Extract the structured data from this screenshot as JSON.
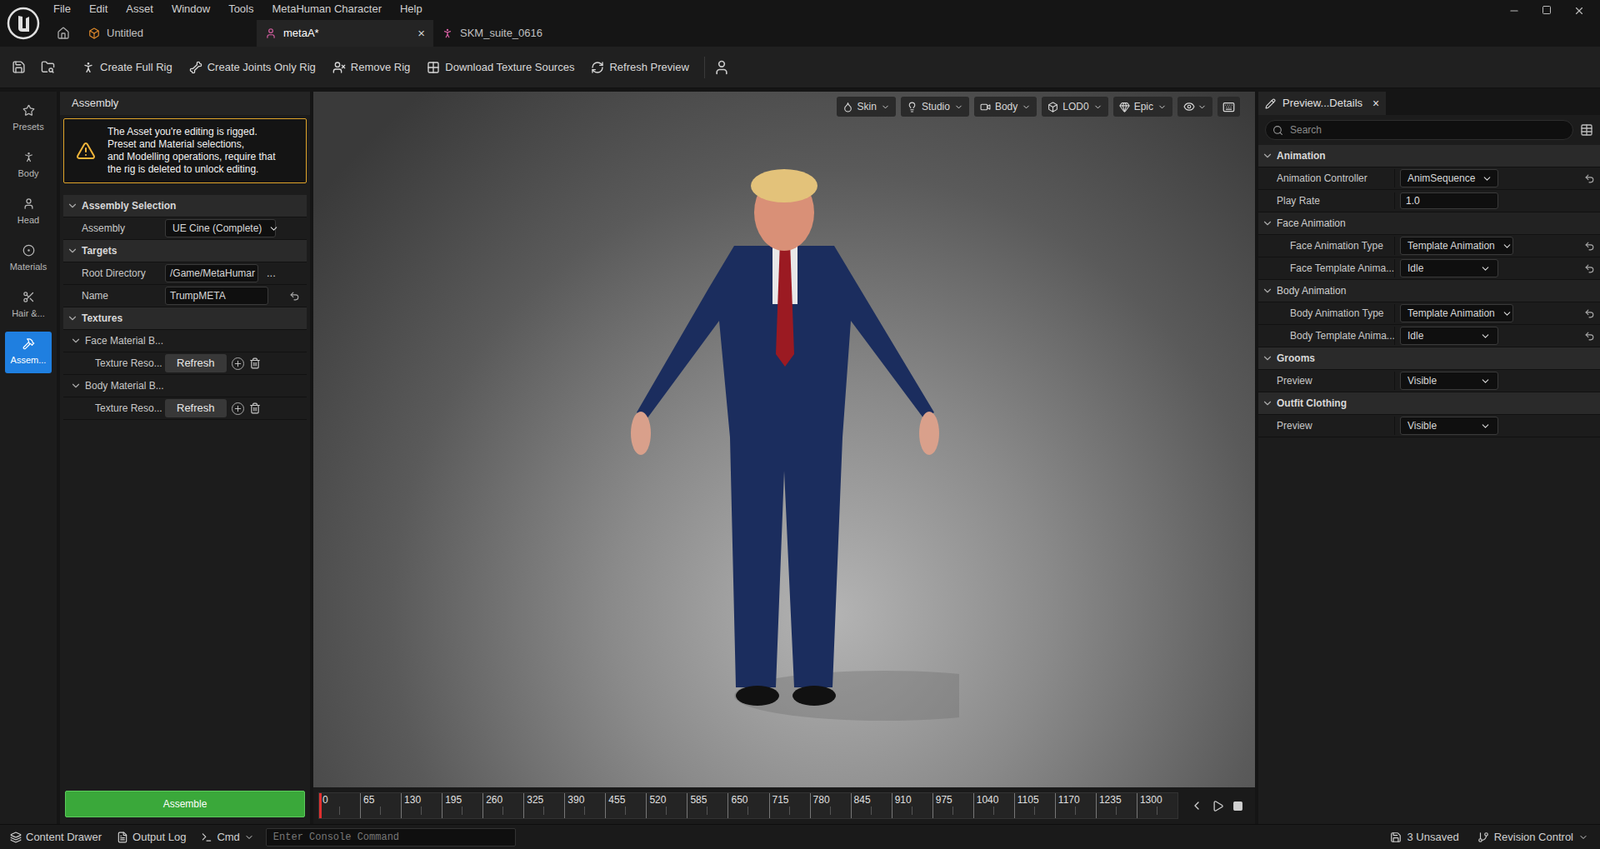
{
  "menu": [
    "File",
    "Edit",
    "Asset",
    "Window",
    "Tools",
    "MetaHuman Character",
    "Help"
  ],
  "tabs": [
    {
      "label": "Untitled",
      "selected": false,
      "close": ""
    },
    {
      "label": "metaA*",
      "selected": true,
      "close": "×"
    },
    {
      "label": "SKM_suite_0616",
      "selected": false,
      "close": ""
    }
  ],
  "toolbar": [
    "Create Full Rig",
    "Create Joints Only Rig",
    "Remove Rig",
    "Download Texture Sources",
    "Refresh Preview"
  ],
  "sidebar": {
    "items": [
      {
        "label": "Presets",
        "selected": false
      },
      {
        "label": "Body",
        "selected": false
      },
      {
        "label": "Head",
        "selected": false
      },
      {
        "label": "Materials",
        "selected": false
      },
      {
        "label": "Hair &...",
        "selected": false
      },
      {
        "label": "Assem...",
        "selected": true
      }
    ]
  },
  "assembly_panel": {
    "title": "Assembly",
    "warning": [
      "The Asset you're editing is rigged.",
      "Preset and Material selections,",
      "and Modelling operations, require that",
      "the rig is deleted to unlock editing."
    ],
    "sections": [
      {
        "title": "Assembly Selection",
        "expanded": true,
        "rows": [
          {
            "kind": "dropdown",
            "label": "Assembly",
            "value": "UE Cine (Complete)",
            "reset": false
          }
        ]
      },
      {
        "title": "Targets",
        "expanded": true,
        "rows": [
          {
            "kind": "path",
            "label": "Root Directory",
            "value": "/Game/MetaHumar",
            "button": "...",
            "reset": false
          },
          {
            "kind": "text",
            "label": "Name",
            "value": "TrumpMETA",
            "reset": true
          }
        ]
      },
      {
        "title": "Textures",
        "expanded": true,
        "rows": [
          {
            "kind": "group",
            "label": "Face Material B...",
            "expanded": true
          },
          {
            "kind": "refresh",
            "label": "Texture Reso...",
            "value": "Refresh"
          },
          {
            "kind": "group",
            "label": "Body Material B...",
            "expanded": true
          },
          {
            "kind": "refresh",
            "label": "Texture Reso...",
            "value": "Refresh"
          }
        ]
      }
    ],
    "assemble_button": "Assemble"
  },
  "viewport": {
    "toolbar": [
      "Skin",
      "Studio",
      "Body",
      "LOD0",
      "Epic"
    ]
  },
  "timeline": {
    "ticks": [
      "0",
      "65",
      "130",
      "195",
      "260",
      "325",
      "390",
      "455",
      "520",
      "585",
      "650",
      "715",
      "780",
      "845",
      "910",
      "975",
      "1040",
      "1105",
      "1170",
      "1235",
      "1300"
    ],
    "level": 0
  },
  "details": {
    "tab": "Preview...Details",
    "close": "×",
    "search_placeholder": "Search",
    "sections": [
      {
        "title": "Animation",
        "level": 0,
        "expanded": true,
        "rows": [
          {
            "kind": "dropdown",
            "label": "Animation Controller",
            "value": "AnimSequence",
            "reset": true
          },
          {
            "kind": "input",
            "label": "Play Rate",
            "value": "1.0",
            "reset": false
          }
        ]
      },
      {
        "title": "Face Animation",
        "level": 0,
        "expanded": true,
        "rows": [
          {
            "kind": "dropdown",
            "label": "Face Animation Type",
            "value": "Template Animation",
            "reset": true
          },
          {
            "kind": "dropdown",
            "label": "Face Template Anima...",
            "value": "Idle",
            "reset": true
          }
        ]
      },
      {
        "title": "Body Animation",
        "level": 0,
        "expanded": true,
        "rows": [
          {
            "kind": "dropdown",
            "label": "Body Animation Type",
            "value": "Template Animation",
            "reset": true
          },
          {
            "kind": "dropdown",
            "label": "Body Template Anima...",
            "value": "Idle",
            "reset": true
          }
        ]
      },
      {
        "title": "Grooms",
        "level": 0,
        "expanded": true,
        "rows": [
          {
            "kind": "dropdown",
            "label": "Preview",
            "value": "Visible",
            "reset": false
          }
        ]
      },
      {
        "title": "Outfit Clothing",
        "level": 0,
        "expanded": true,
        "rows": [
          {
            "kind": "dropdown",
            "label": "Preview",
            "value": "Visible",
            "reset": false
          }
        ]
      }
    ]
  },
  "status_bar": {
    "left": [
      "Content Drawer",
      "Output Log",
      "Cmd"
    ],
    "console_placeholder": "Enter Console Command",
    "unsaved": "3 Unsaved",
    "revision": "Revision Control"
  }
}
